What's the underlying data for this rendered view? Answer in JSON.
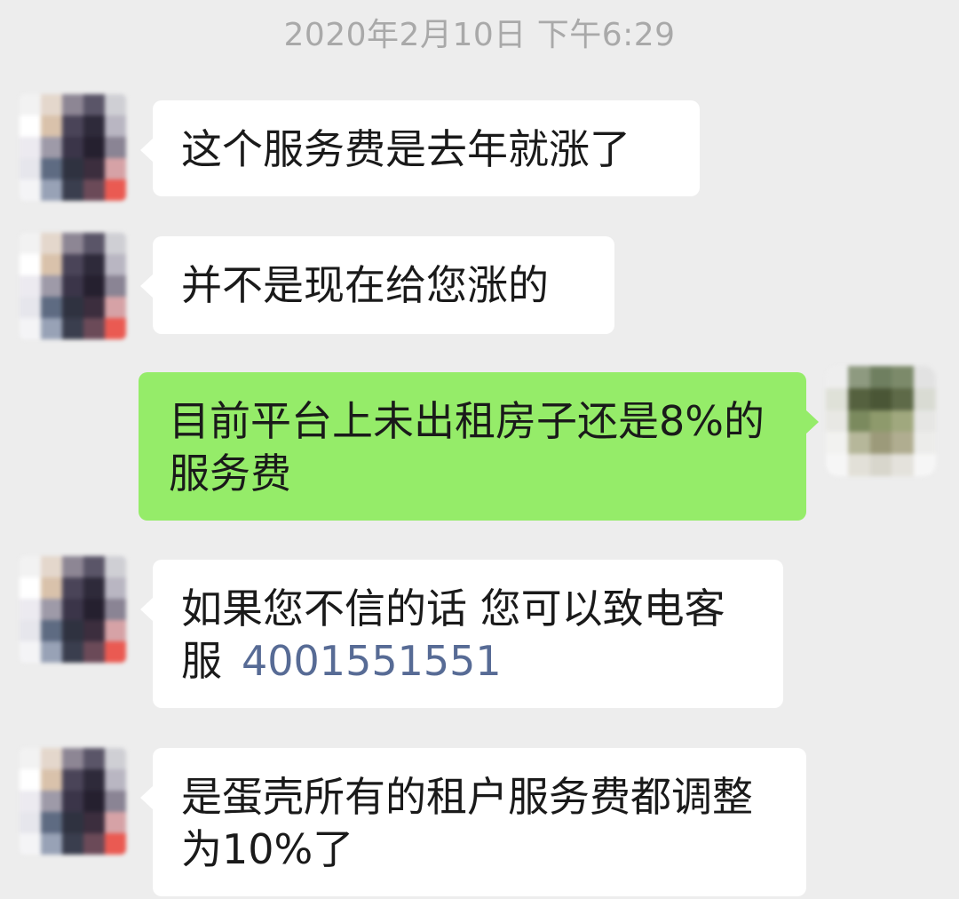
{
  "header": {
    "timestamp": "2020年2月10日 下午6:29"
  },
  "colors": {
    "background": "#ededed",
    "incoming_bubble": "#ffffff",
    "outgoing_bubble": "#95ec69",
    "link": "#576b95",
    "timestamp_text": "#a9a9a9"
  },
  "messages": [
    {
      "direction": "incoming",
      "lines": [
        "这个服务费是去年就涨了"
      ]
    },
    {
      "direction": "incoming",
      "lines": [
        "并不是现在给您涨的"
      ]
    },
    {
      "direction": "outgoing",
      "lines": [
        "目前平台上未出租房子还是8%的",
        "服务费"
      ]
    },
    {
      "direction": "incoming",
      "lines": [
        "如果您不信的话  您可以致电客",
        "服"
      ],
      "phone": "4001551551"
    },
    {
      "direction": "incoming",
      "lines": [
        "是蛋壳所有的租户服务费都调整",
        "为10%了"
      ]
    }
  ],
  "icons": {
    "contact_avatar": "blurred-avatar-icon",
    "self_avatar": "blurred-avatar-icon"
  }
}
